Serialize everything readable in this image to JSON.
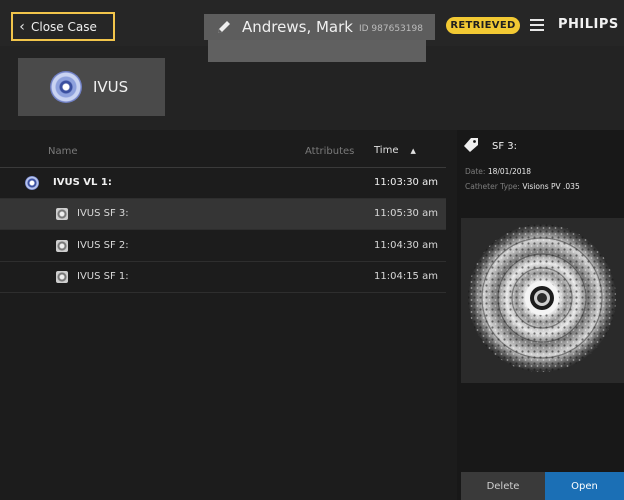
{
  "header": {
    "close_label": "Close Case",
    "patient_name": "Andrews, Mark",
    "patient_id": "ID 987653198",
    "status_badge": "RETRIEVED",
    "brand": "PHILIPS"
  },
  "mode": {
    "label": "IVUS"
  },
  "list": {
    "columns": {
      "name": "Name",
      "attributes": "Attributes",
      "time": "Time"
    },
    "rows": [
      {
        "name": "IVUS VL 1:",
        "time": "11:03:30 am"
      },
      {
        "name": "IVUS SF 3:",
        "time": "11:05:30 am"
      },
      {
        "name": "IVUS SF 2:",
        "time": "11:04:30 am"
      },
      {
        "name": "IVUS SF 1:",
        "time": "11:04:15 am"
      }
    ]
  },
  "details": {
    "title": "SF 3:",
    "date_label": "Date:",
    "date_value": "18/01/2018",
    "catheter_label": "Catheter Type:",
    "catheter_value": "Visions PV .035",
    "delete_label": "Delete",
    "open_label": "Open"
  },
  "colors": {
    "accent_yellow": "#f2c933",
    "open_blue": "#1b6fb5"
  }
}
